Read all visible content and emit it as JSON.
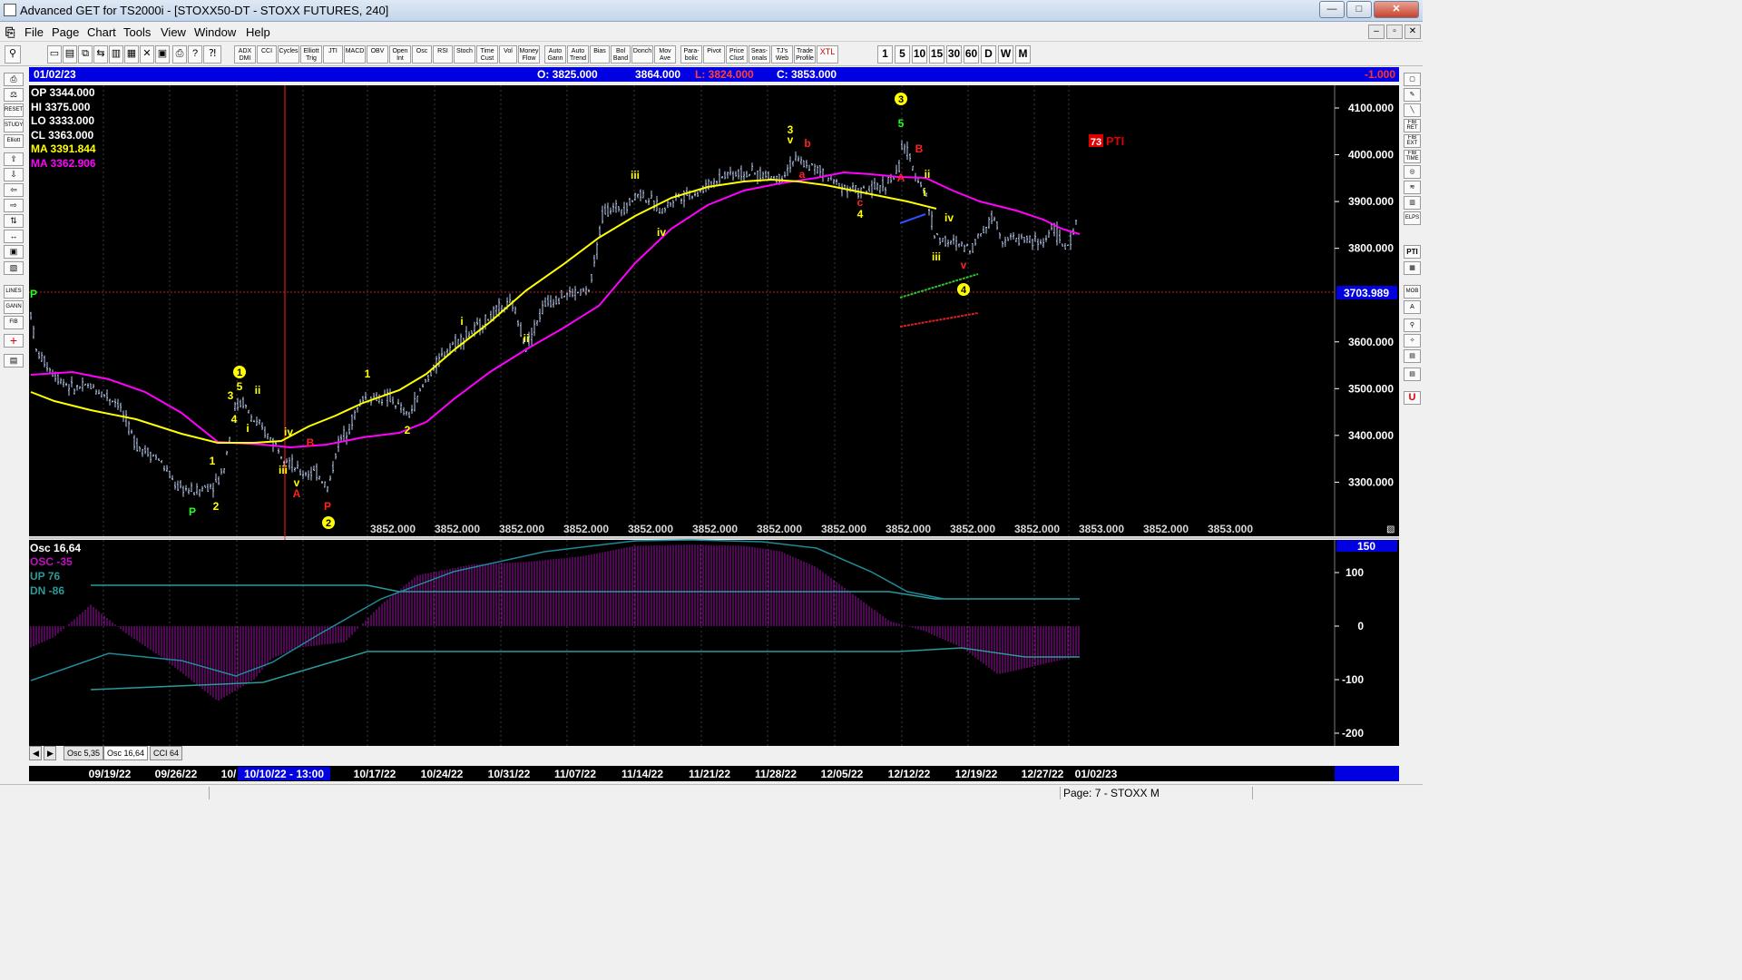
{
  "window": {
    "title": "Advanced GET for TS2000i - [STOXX50-DT - STOXX FUTURES, 240]",
    "minimize": "—",
    "maximize": "□",
    "close": "✕"
  },
  "menu": {
    "items": [
      "File",
      "Page",
      "Chart",
      "Tools",
      "View",
      "Window",
      "Help"
    ]
  },
  "toolbar": {
    "studies": [
      "ADX DMI",
      "CCI",
      "Cycles",
      "Elliott Trig",
      "JTI",
      "MACD",
      "OBV",
      "Open Int",
      "Osc",
      "RSI",
      "Stoch",
      "Time Cust",
      "Vol",
      "Money Flow",
      "Auto Gann",
      "Auto Trend",
      "Bias",
      "Bol Band",
      "Donch",
      "Mov Ave",
      "Para-bolic",
      "Pivot",
      "Price Clust",
      "Seas-onals",
      "TJ's Web",
      "Trade Profile",
      "XTL"
    ],
    "periods": [
      "1",
      "5",
      "10",
      "15",
      "30",
      "60",
      "D",
      "W",
      "M"
    ]
  },
  "left_tools": [
    "RESET",
    "STUDY",
    "Elliott",
    "LINES",
    "GANN",
    "FIB"
  ],
  "right_tools": [
    "FIB RET",
    "FIB EXT",
    "FIB TIME",
    "ELPS",
    "PTI",
    "MOB",
    "U"
  ],
  "header": {
    "date": "01/02/23",
    "open": "O: 3825.000",
    "high": "3864.000",
    "low": "L: 3824.000",
    "close": "C: 3853.000",
    "change": "-1.000"
  },
  "info": {
    "op": "OP  3344.000",
    "hi": "HI   3375.000",
    "lo": "LO  3333.000",
    "cl": "CL  3363.000",
    "ma1": "MA  3391.844",
    "ma2": "MA  3362.906"
  },
  "price_axis": {
    "ticks": [
      "4100.000",
      "4000.000",
      "3900.000",
      "3800.000",
      "3600.000",
      "3500.000",
      "3400.000",
      "3300.000"
    ],
    "cursor": "3703.989"
  },
  "bottom_values": [
    "3852.000",
    "3852.000",
    "3852.000",
    "3852.000",
    "3852.000",
    "3852.000",
    "3852.000",
    "3852.000",
    "3852.000",
    "3852.000",
    "3852.000",
    "3853.000",
    "3852.000",
    "3853.000"
  ],
  "pti": {
    "value": "73",
    "label": "PTI"
  },
  "elliott_labels": [
    {
      "t": "P",
      "c": "#22ff22"
    },
    {
      "t": "P",
      "c": "#22ff22"
    },
    {
      "t": "2",
      "c": "#ffff00"
    },
    {
      "t": "1",
      "c": "#ffff00"
    },
    {
      "t": "1",
      "c": "#ffff00",
      "circle": true
    },
    {
      "t": "5",
      "c": "#ffff00"
    },
    {
      "t": "3",
      "c": "#ffff00"
    },
    {
      "t": "4",
      "c": "#ffff00"
    },
    {
      "t": "ii",
      "c": "#ffff00"
    },
    {
      "t": "i",
      "c": "#ffff00"
    },
    {
      "t": "iv",
      "c": "#ffff00"
    },
    {
      "t": "iii",
      "c": "#ffff00"
    },
    {
      "t": "v",
      "c": "#ffff00"
    },
    {
      "t": "A",
      "c": "#ff2222"
    },
    {
      "t": "B",
      "c": "#ff2222"
    },
    {
      "t": "P",
      "c": "#ff2222"
    },
    {
      "t": "2",
      "c": "#ffff00",
      "circle": true
    },
    {
      "t": "1",
      "c": "#ffff00"
    },
    {
      "t": "2",
      "c": "#ffff00"
    },
    {
      "t": "i",
      "c": "#ffff00"
    },
    {
      "t": "ii",
      "c": "#ffff00"
    },
    {
      "t": "iii",
      "c": "#ffff00"
    },
    {
      "t": "iv",
      "c": "#ffff00"
    },
    {
      "t": "3",
      "c": "#ffff00"
    },
    {
      "t": "v",
      "c": "#ffff00"
    },
    {
      "t": "b",
      "c": "#ff2222"
    },
    {
      "t": "a",
      "c": "#ff2222"
    },
    {
      "t": "c",
      "c": "#ff2222"
    },
    {
      "t": "4",
      "c": "#ffff00"
    },
    {
      "t": "3",
      "c": "#ffff00",
      "circle": true
    },
    {
      "t": "5",
      "c": "#22ff22"
    },
    {
      "t": "B",
      "c": "#ff2222"
    },
    {
      "t": "A",
      "c": "#ff2222"
    },
    {
      "t": "ii",
      "c": "#ffff00"
    },
    {
      "t": "i",
      "c": "#ffff00"
    },
    {
      "t": "iv",
      "c": "#ffff00"
    },
    {
      "t": "iii",
      "c": "#ffff00"
    },
    {
      "t": "v",
      "c": "#ff2222"
    },
    {
      "t": "4",
      "c": "#ffff00",
      "circle": true
    }
  ],
  "osc_panel": {
    "title": "Osc 16,64",
    "osc": "OSC -35",
    "up": "UP  76",
    "dn": "DN  -86",
    "ticks": [
      "150",
      "100",
      "0",
      "-100",
      "-200"
    ]
  },
  "tabs": [
    "Osc 5,35",
    "Osc 16,64",
    "CCI 64"
  ],
  "date_axis": {
    "labels": [
      "09/19/22",
      "09/26/22",
      "10/",
      "10/17/22",
      "10/24/22",
      "10/31/22",
      "11/07/22",
      "11/14/22",
      "11/21/22",
      "11/28/22",
      "12/05/22",
      "12/12/22",
      "12/19/22",
      "12/27/22",
      "01/02/23"
    ],
    "cursor": "10/10/22 - 13:00"
  },
  "status": {
    "page": "Page: 7 - STOXX M"
  },
  "colors": {
    "bg": "#000000",
    "ma_fast": "#ffff00",
    "ma_slow": "#ff00ff",
    "bars": "#b8ccf0",
    "osc": "#c010c0",
    "bands": "#2a9a9a",
    "cursor": "#ff2020",
    "header": "#0000e0"
  }
}
